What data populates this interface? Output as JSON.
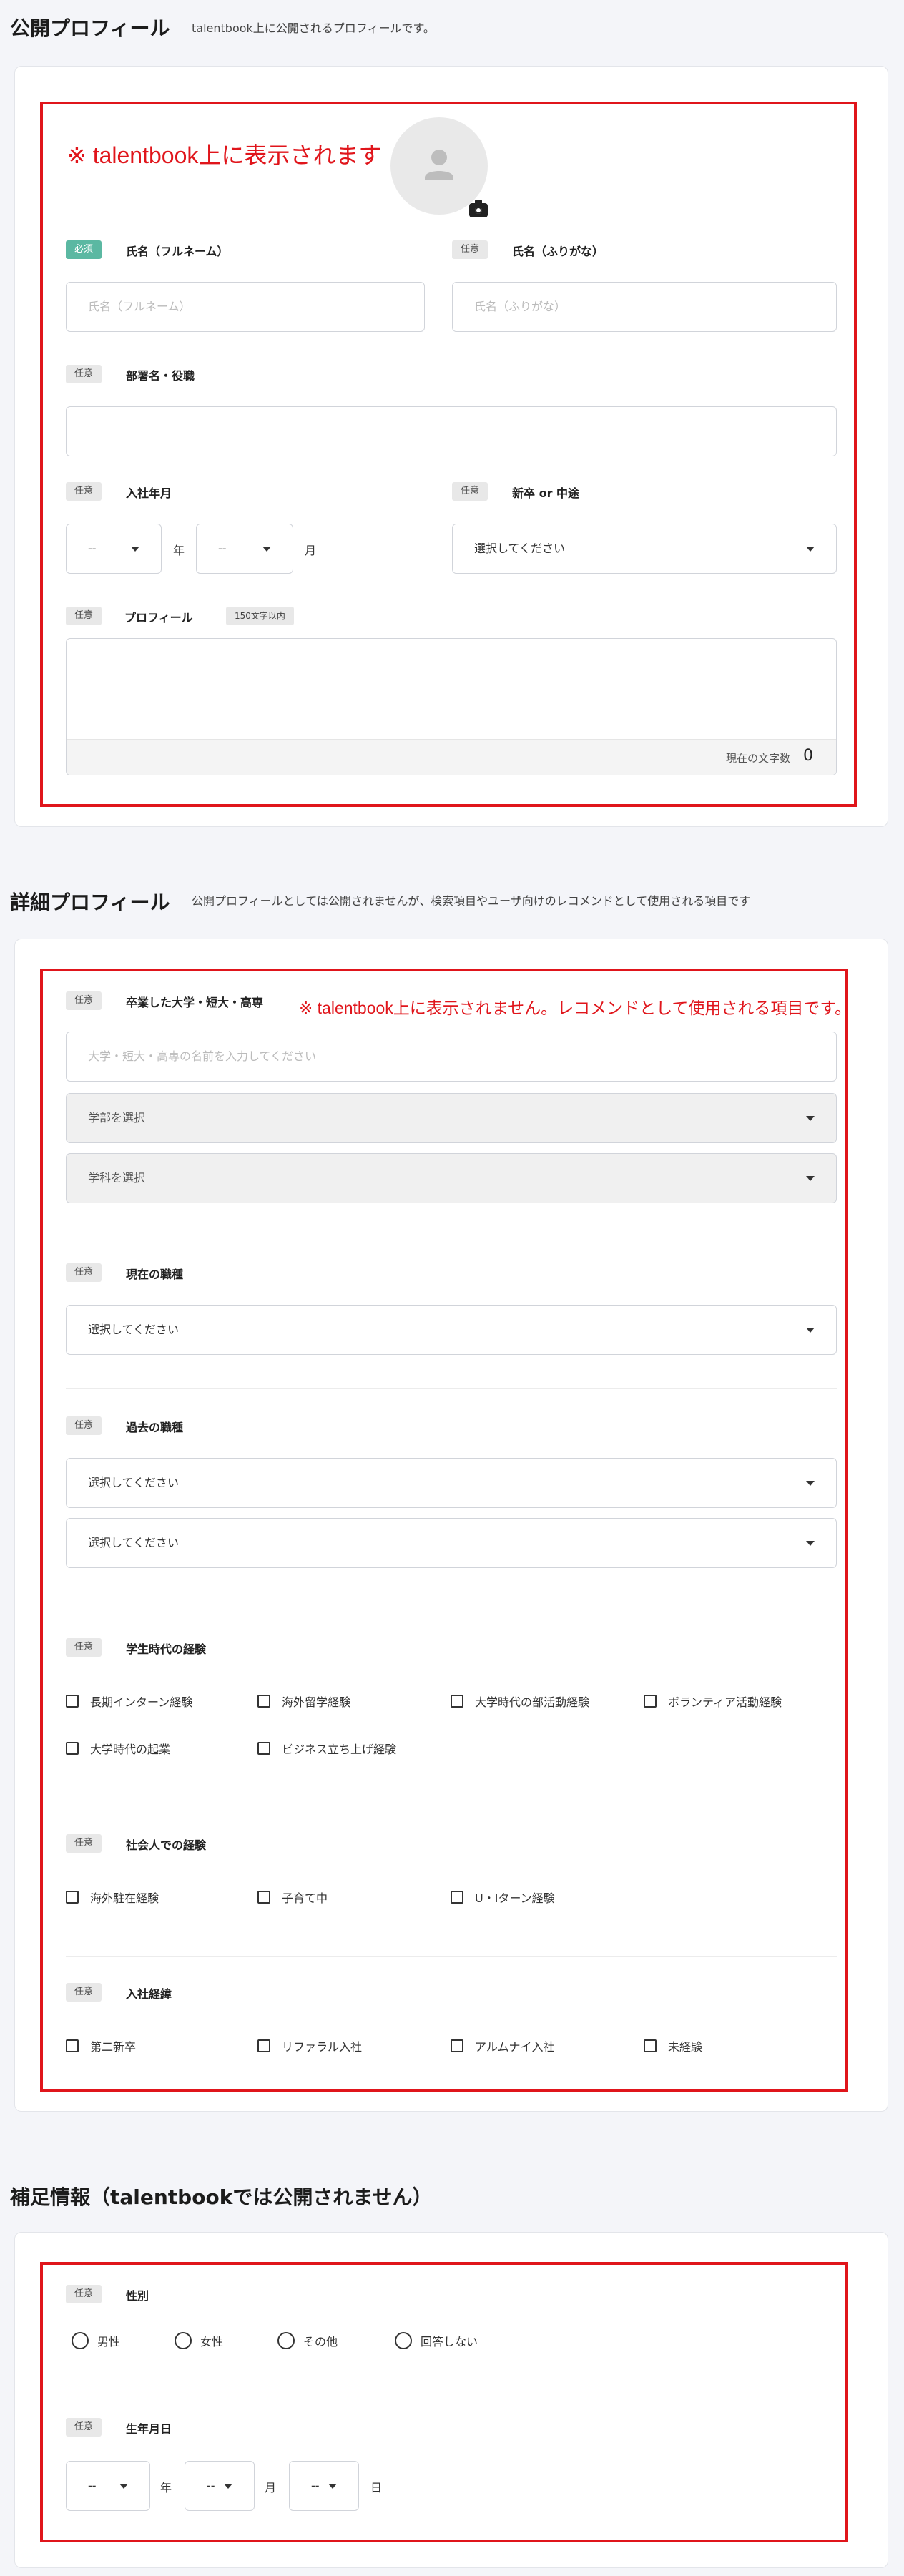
{
  "public_profile": {
    "title": "公開プロフィール",
    "description": "talentbook上に公開されるプロフィールです。",
    "note": "※ talentbook上に表示されます",
    "name_full": {
      "badge": "必須",
      "label": "氏名（フルネーム）",
      "placeholder": "氏名（フルネーム）"
    },
    "name_kana": {
      "badge": "任意",
      "label": "氏名（ふりがな）",
      "placeholder": "氏名（ふりがな）"
    },
    "department": {
      "badge": "任意",
      "label": "部署名・役職",
      "value": ""
    },
    "join_date": {
      "badge": "任意",
      "label": "入社年月",
      "year_value": "--",
      "year_unit": "年",
      "month_value": "--",
      "month_unit": "月"
    },
    "hire_type": {
      "badge": "任意",
      "label": "新卒 or 中途",
      "value": "選択してください"
    },
    "profile": {
      "badge": "任意",
      "label": "プロフィール",
      "limit": "150文字以内",
      "counter_label": "現在の文字数",
      "counter_value": "0"
    }
  },
  "detail_profile": {
    "title": "詳細プロフィール",
    "description": "公開プロフィールとしては公開されませんが、検索項目やユーザ向けのレコメンドとして使用される項目です",
    "note": "※ talentbook上に表示されません。レコメンドとして使用される項目です。",
    "school": {
      "badge": "任意",
      "label": "卒業した大学・短大・高専",
      "placeholder": "大学・短大・高専の名前を入力してください",
      "faculty": "学部を選択",
      "department": "学科を選択"
    },
    "current_job": {
      "badge": "任意",
      "label": "現在の職種",
      "value": "選択してください"
    },
    "past_job": {
      "badge": "任意",
      "label": "過去の職種",
      "value1": "選択してください",
      "value2": "選択してください"
    },
    "student_exp": {
      "badge": "任意",
      "label": "学生時代の経験",
      "options": [
        "長期インターン経験",
        "海外留学経験",
        "大学時代の部活動経験",
        "ボランティア活動経験",
        "大学時代の起業",
        "ビジネス立ち上げ経験"
      ]
    },
    "work_exp": {
      "badge": "任意",
      "label": "社会人での経験",
      "options": [
        "海外駐在経験",
        "子育て中",
        "U・Iターン経験"
      ]
    },
    "join_path": {
      "badge": "任意",
      "label": "入社経緯",
      "options": [
        "第二新卒",
        "リファラル入社",
        "アルムナイ入社",
        "未経験"
      ]
    }
  },
  "extra_info": {
    "title": "補足情報（talentbookでは公開されません）",
    "gender": {
      "badge": "任意",
      "label": "性別",
      "options": [
        "男性",
        "女性",
        "その他",
        "回答しない"
      ]
    },
    "birth": {
      "badge": "任意",
      "label": "生年月日",
      "year_value": "--",
      "year_unit": "年",
      "month_value": "--",
      "month_unit": "月",
      "day_value": "--",
      "day_unit": "日"
    }
  },
  "icons": {
    "avatar": "person-icon",
    "camera": "camera-icon",
    "dropdown": "caret-down-icon"
  },
  "colors": {
    "required_badge": "#5bb8a2",
    "annotation": "#e0151b",
    "background": "#f4f5f9"
  }
}
